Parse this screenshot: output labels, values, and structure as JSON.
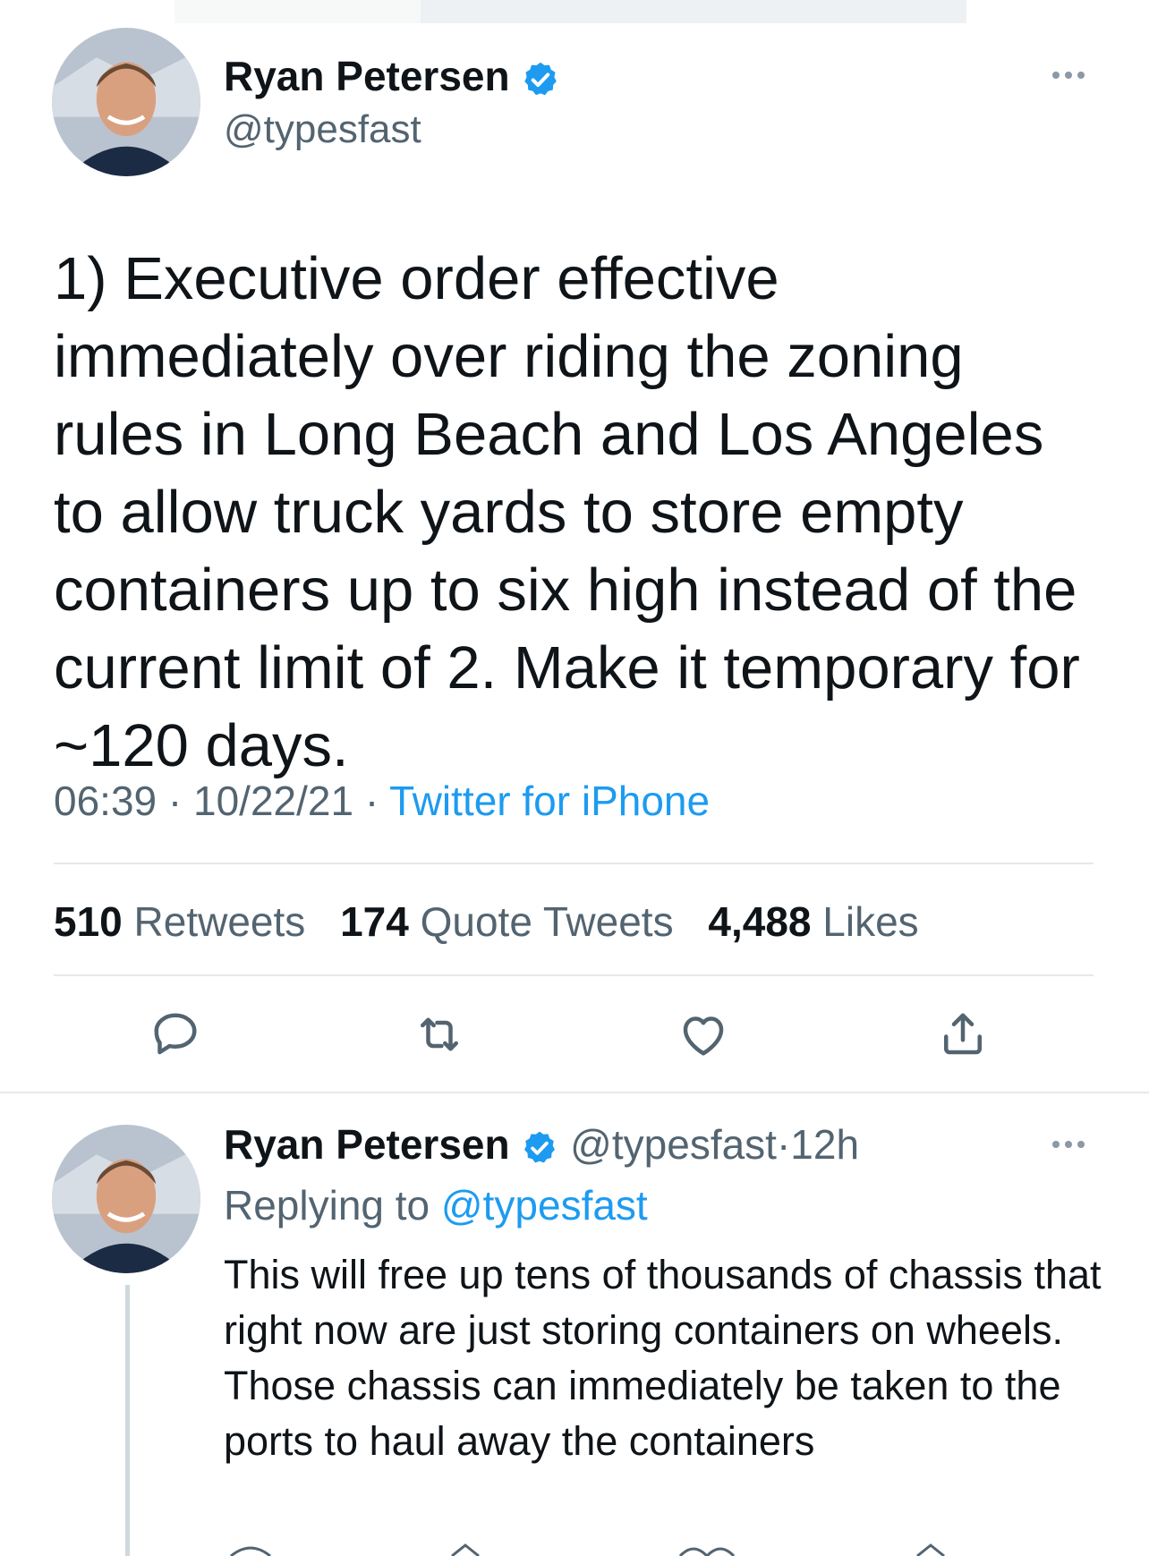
{
  "tweet": {
    "author_name": "Ryan Petersen",
    "handle": "@typesfast",
    "text": "1) Executive order effective immediately over riding the zoning rules in Long Beach and Los Angeles to allow truck yards to store empty containers up to six high instead of the current limit of 2. Make it temporary for ~120 days.",
    "time": "06:39",
    "date": "10/22/21",
    "separator": "·",
    "source": "Twitter for iPhone",
    "stats": {
      "retweets_count": "510",
      "retweets_label": "Retweets",
      "quotes_count": "174",
      "quotes_label": "Quote Tweets",
      "likes_count": "4,488",
      "likes_label": "Likes"
    },
    "icons": [
      "reply-icon",
      "retweet-icon",
      "like-icon",
      "share-icon"
    ]
  },
  "reply": {
    "author_name": "Ryan Petersen",
    "handle": "@typesfast",
    "age": "12h",
    "separator": "·",
    "replying_prefix": "Replying to",
    "replying_handle": "@typesfast",
    "text": "This will free up tens of thousands of chassis that right now are just storing containers on wheels. Those chassis can immediately be taken to the ports to haul away the containers"
  },
  "colors": {
    "accent": "#1d9bf0",
    "text": "#0f1419",
    "secondary": "#536471",
    "divider": "#e6e9eb"
  }
}
